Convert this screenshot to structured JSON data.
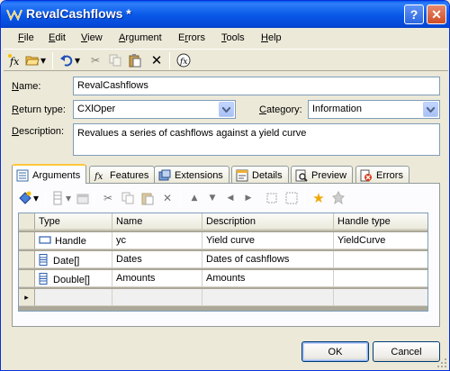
{
  "window": {
    "title": "RevalCashflows *"
  },
  "menu": [
    "File",
    "Edit",
    "View",
    "Argument",
    "Errors",
    "Tools",
    "Help"
  ],
  "menu_underline": [
    "F",
    "E",
    "V",
    "A",
    "r",
    "T",
    "H"
  ],
  "form": {
    "name_label": "Name:",
    "name_value": "RevalCashflows",
    "return_type_label": "Return type:",
    "return_type_value": "CXlOper",
    "category_label": "Category:",
    "category_value": "Information",
    "description_label": "Description:",
    "description_value": "Revalues a series of cashflows against a yield curve"
  },
  "tabs": [
    {
      "label": "Arguments",
      "icon": "arguments-icon",
      "active": true
    },
    {
      "label": "Features",
      "icon": "function-icon",
      "active": false
    },
    {
      "label": "Extensions",
      "icon": "extensions-icon",
      "active": false
    },
    {
      "label": "Details",
      "icon": "details-icon",
      "active": false
    },
    {
      "label": "Preview",
      "icon": "preview-icon",
      "active": false
    },
    {
      "label": "Errors",
      "icon": "errors-icon",
      "active": false
    }
  ],
  "grid": {
    "columns": [
      "Type",
      "Name",
      "Description",
      "Handle type"
    ],
    "rows": [
      {
        "type": "Handle",
        "type_icon": "handle-icon",
        "name": "yc",
        "description": "Yield curve",
        "handle_type": "YieldCurve"
      },
      {
        "type": "Date[]",
        "type_icon": "array-icon",
        "name": "Dates",
        "description": "Dates of cashflows",
        "handle_type": ""
      },
      {
        "type": "Double[]",
        "type_icon": "array-icon",
        "name": "Amounts",
        "description": "Amounts",
        "handle_type": ""
      }
    ]
  },
  "buttons": {
    "ok": "OK",
    "cancel": "Cancel"
  },
  "colors": {
    "titlebar": "#0a5ae8",
    "face": "#ece9d8",
    "tab_active_accent": "#ffc83c"
  }
}
